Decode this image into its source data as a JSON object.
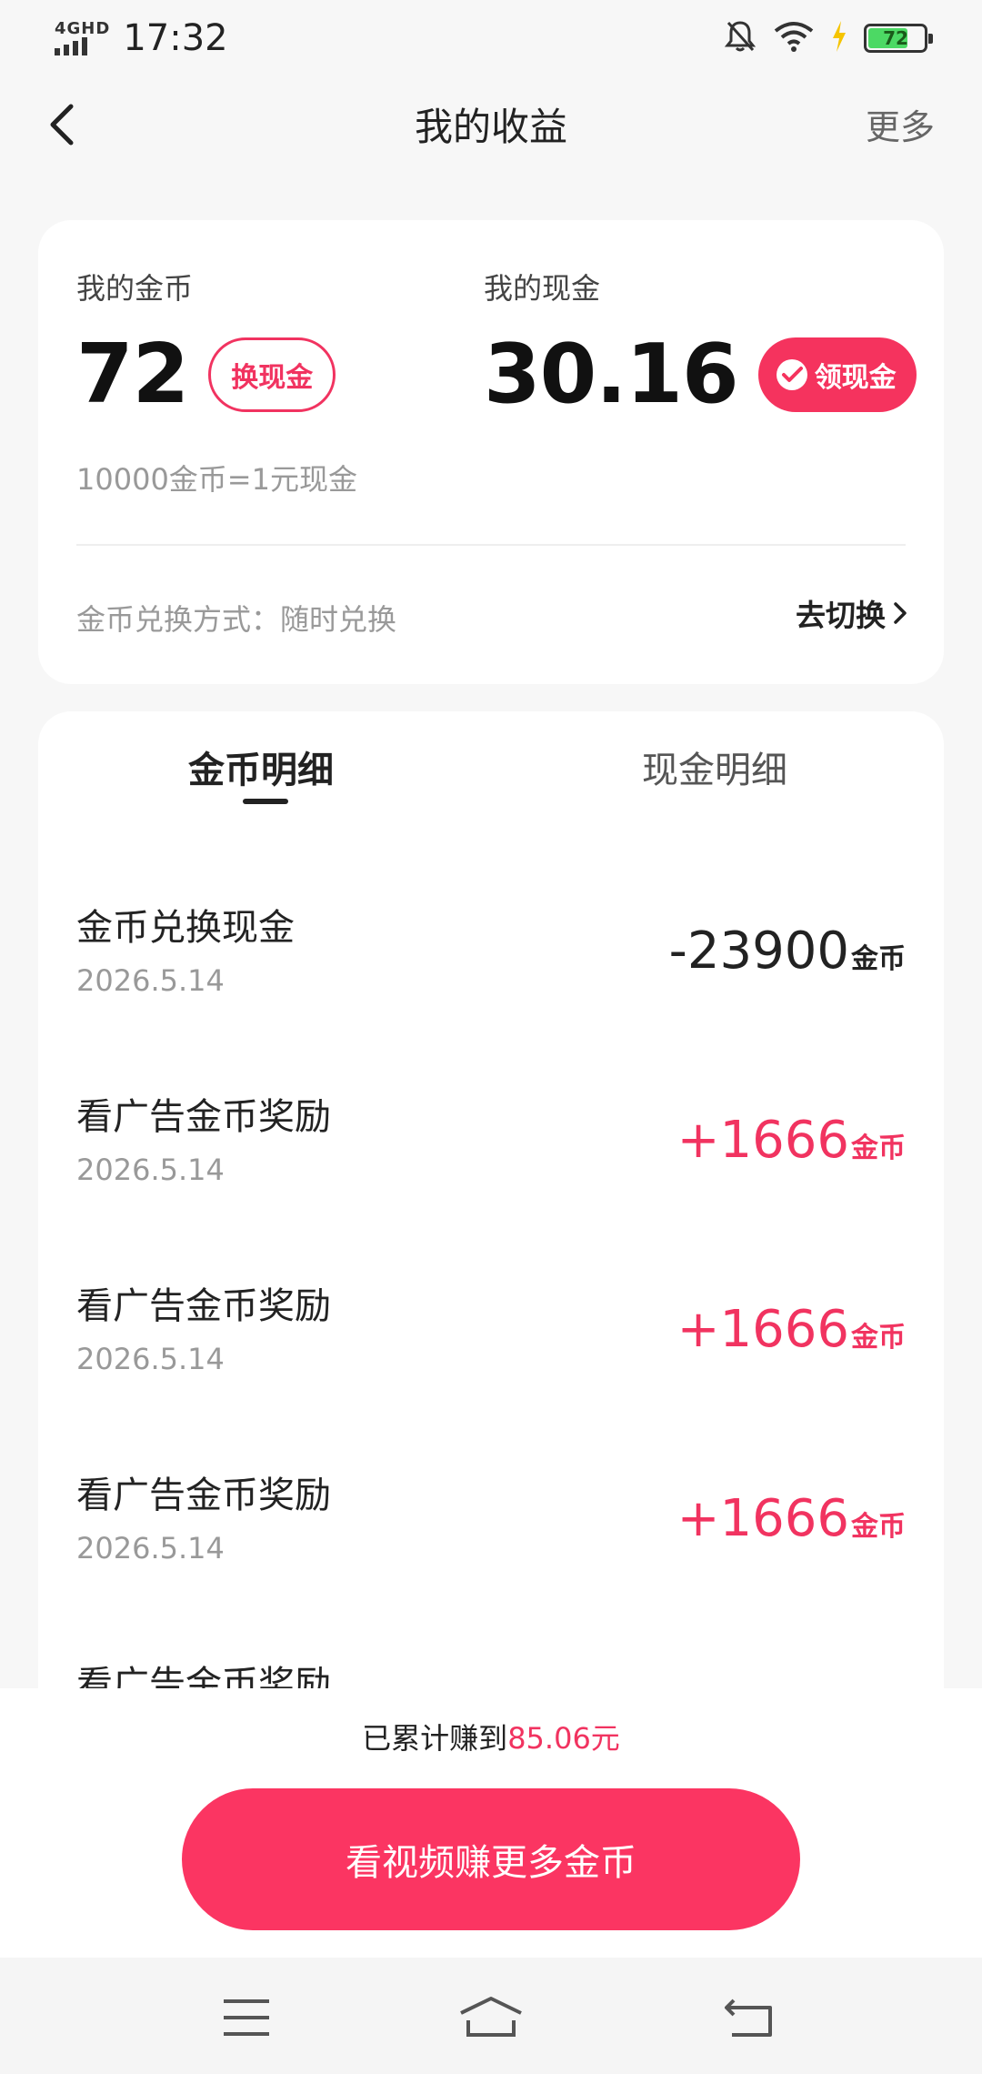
{
  "status_bar": {
    "network": "4GHD",
    "time": "17:32",
    "battery": "72",
    "battery_level": 0.72
  },
  "header": {
    "title": "我的收益",
    "more": "更多"
  },
  "balance": {
    "coins_label": "我的金币",
    "coins_value": "72",
    "exchange_btn": "换现金",
    "cash_label": "我的现金",
    "cash_value": "30.16",
    "withdraw_btn": "领现金",
    "rate": "10000金币=1元现金",
    "exchange_mode": "金币兑换方式：随时兑换",
    "switch_link": "去切换"
  },
  "tabs": {
    "coins_detail": "金币明细",
    "cash_detail": "现金明细"
  },
  "records": [
    {
      "title": "金币兑换现金",
      "date": "2026.5.14",
      "amount": "-23900",
      "unit": "金币",
      "type": "neg"
    },
    {
      "title": "看广告金币奖励",
      "date": "2026.5.14",
      "amount": "+1666",
      "unit": "金币",
      "type": "pos"
    },
    {
      "title": "看广告金币奖励",
      "date": "2026.5.14",
      "amount": "+1666",
      "unit": "金币",
      "type": "pos"
    },
    {
      "title": "看广告金币奖励",
      "date": "2026.5.14",
      "amount": "+1666",
      "unit": "金币",
      "type": "pos"
    },
    {
      "title": "看广告金币奖励",
      "date": "",
      "amount": "",
      "unit": "",
      "type": "pos"
    }
  ],
  "footer": {
    "total_prefix": "已累计赚到",
    "total_value": "85.06元",
    "cta": "看视频赚更多金币"
  },
  "colors": {
    "accent": "#f13360",
    "cta": "#fb3562"
  }
}
